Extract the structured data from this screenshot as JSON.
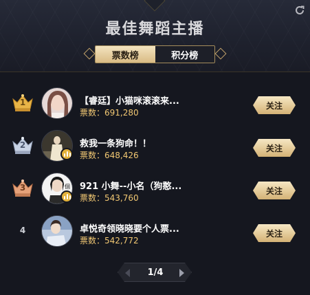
{
  "header": {
    "title": "最佳舞蹈主播",
    "tabs": [
      {
        "label": "票数榜",
        "active": true
      },
      {
        "label": "积分榜",
        "active": false
      }
    ]
  },
  "colors": {
    "gold": "#f2c873",
    "accent_light": "#f3e4c0",
    "background": "#15171f"
  },
  "ranking": [
    {
      "rank": "1",
      "name": "【睿廷】小猫咪滚滚来...",
      "votes": "票数：691,280",
      "follow": "关注",
      "badge": "gold-crown-icon",
      "live": false
    },
    {
      "rank": "2",
      "name": "救我一条狗命！！",
      "votes": "票数：648,426",
      "follow": "关注",
      "badge": "silver-crown-icon",
      "live": true
    },
    {
      "rank": "3",
      "name": "921 小舞--小名（狗憨...",
      "votes": "票数：543,760",
      "follow": "关注",
      "badge": "bronze-crown-icon",
      "live": true
    },
    {
      "rank": "4",
      "name": "卓悦奇领晓晓要个人票...",
      "votes": "票数：542,772",
      "follow": "关注",
      "badge": null,
      "live": false
    }
  ],
  "pager": {
    "text": "1/4"
  }
}
